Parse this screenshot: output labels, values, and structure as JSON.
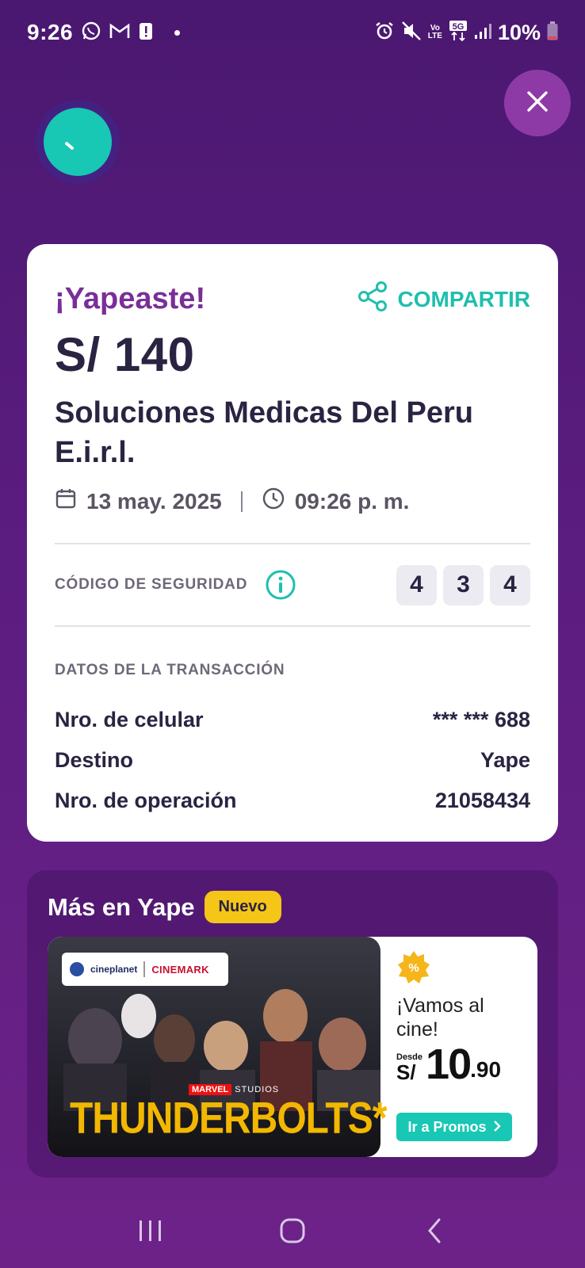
{
  "status_bar": {
    "time": "9:26",
    "battery": "10%",
    "network_top": "5G",
    "volte": "Vo\nLTE"
  },
  "receipt": {
    "title": "¡Yapeaste!",
    "share_label": "COMPARTIR",
    "amount": "S/ 140",
    "merchant": "Soluciones Medicas Del Peru E.i.r.l.",
    "date": "13 may. 2025",
    "time": "09:26 p. m.",
    "security_label": "CÓDIGO DE SEGURIDAD",
    "security_code": [
      "4",
      "3",
      "4"
    ],
    "transaction_title": "DATOS DE LA TRANSACCIÓN",
    "transaction_rows": [
      {
        "label": "Nro. de celular",
        "value": "*** *** 688"
      },
      {
        "label": "Destino",
        "value": "Yape"
      },
      {
        "label": "Nro. de operación",
        "value": "21058434"
      }
    ]
  },
  "more": {
    "title": "Más en Yape",
    "badge": "Nuevo",
    "banner": {
      "brand_a": "cineplanet",
      "brand_b": "CINEMARK",
      "studio_a": "MARVEL",
      "studio_b": "STUDIOS",
      "movie": "THUNDERBOLTS*",
      "headline": "¡Vamos al cine!",
      "price_prefix": "Desde",
      "currency": "S/",
      "price_int": "10",
      "price_dec": ".90",
      "cta": "Ir a Promos"
    }
  },
  "colors": {
    "accent_purple": "#7a2e98",
    "teal": "#18c7b4",
    "dark_text": "#2b2342",
    "promo_yellow": "#f5c518"
  }
}
